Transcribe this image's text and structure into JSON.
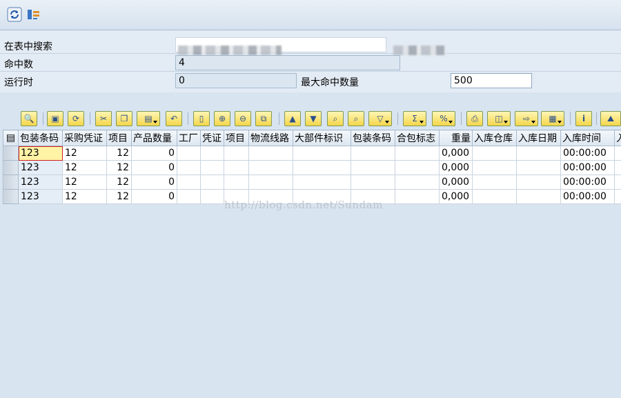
{
  "app_toolbar": {
    "icons": [
      "refresh-icon",
      "settings-transfer-icon"
    ]
  },
  "form": {
    "search_label": "在表中搜索",
    "search_value": "",
    "hits_label": "命中数",
    "hits_value": "4",
    "runtime_label": "运行时",
    "runtime_value": "0",
    "max_hits_label": "最大命中数量",
    "max_hits_value": "500"
  },
  "grid_toolbar": {
    "buttons": [
      "detail-icon",
      "check-icon",
      "refresh-icon",
      "cut-icon",
      "copy-icon",
      "paste-icon",
      "undo-icon",
      "new-row-icon",
      "insert-row-icon",
      "delete-row-icon",
      "copy-row-icon",
      "sort-ascending-icon",
      "sort-descending-icon",
      "find-icon",
      "find-next-icon",
      "filter-icon",
      "sum-icon",
      "subtotal-icon",
      "print-icon",
      "views-icon",
      "export-icon",
      "layout-icon",
      "info-icon",
      "graphic-icon"
    ]
  },
  "table": {
    "columns": [
      "包装条码",
      "采购凭证",
      "项目",
      "产品数量",
      "工厂",
      "凭证",
      "项目",
      "物流线路",
      "大部件标识",
      "包装条码",
      "合包标志",
      "重量",
      "入库仓库",
      "入库日期",
      "入库时间",
      "入"
    ],
    "rows": [
      [
        "123",
        "12",
        "12",
        "0",
        "",
        "",
        "",
        "",
        "",
        "",
        "",
        "0,000",
        "",
        "",
        "00:00:00",
        ""
      ],
      [
        "123",
        "12",
        "12",
        "0",
        "",
        "",
        "",
        "",
        "",
        "",
        "",
        "0,000",
        "",
        "",
        "00:00:00",
        ""
      ],
      [
        "123",
        "12",
        "12",
        "0",
        "",
        "",
        "",
        "",
        "",
        "",
        "",
        "0,000",
        "",
        "",
        "00:00:00",
        ""
      ],
      [
        "123",
        "12",
        "12",
        "0",
        "",
        "",
        "",
        "",
        "",
        "",
        "",
        "0,000",
        "",
        "",
        "00:00:00",
        ""
      ]
    ]
  },
  "watermark": "http://blog.csdn.net/Sundam"
}
